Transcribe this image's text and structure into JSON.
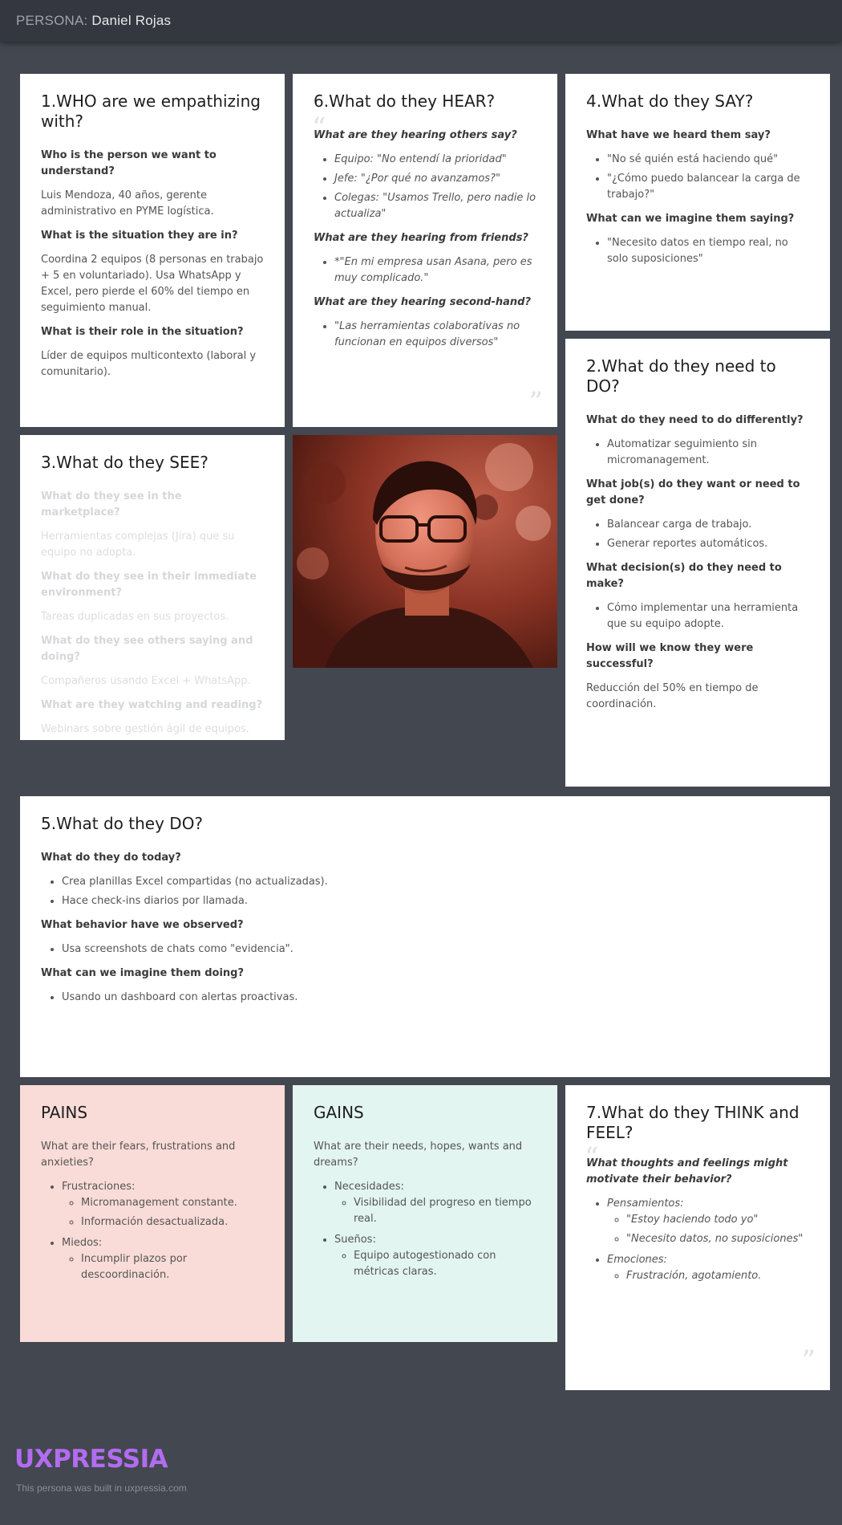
{
  "header": {
    "prefix": "PERSONA:",
    "name": "Daniel Rojas"
  },
  "who": {
    "title": "1.WHO are we empathizing with?",
    "q1": "Who is the person we want to understand?",
    "a1": "Luis Mendoza, 40 años, gerente administrativo en PYME logística.",
    "q2": "What is the situation they are in?",
    "a2": "Coordina 2 equipos (8 personas en trabajo + 5 en voluntariado). Usa WhatsApp y Excel, pero pierde el 60% del tiempo en seguimiento manual.",
    "q3": "What is their role in the situation?",
    "a3": "Líder de equipos multicontexto (laboral y comunitario)."
  },
  "hear": {
    "title": "6.What do they HEAR?",
    "q1": "What are they hearing others say?",
    "items1": [
      "Equipo: \"No entendí la prioridad\"",
      "Jefe: \"¿Por qué no avanzamos?\"",
      "Colegas: \"Usamos Trello, pero nadie lo actualiza\""
    ],
    "q2": "What are they hearing from friends?",
    "items2": [
      "*\"En mi empresa usan Asana, pero es muy complicado.\""
    ],
    "q3": "What are they hearing second-hand?",
    "items3": [
      "\"Las herramientas colaborativas no funcionan en equipos diversos\""
    ]
  },
  "say": {
    "title": "4.What do they SAY?",
    "q1": "What have we heard them say?",
    "items1": [
      "\"No sé quién está haciendo qué\"",
      "\"¿Cómo puedo balancear la carga de trabajo?\""
    ],
    "q2": "What can we imagine them saying?",
    "items2": [
      "\"Necesito datos en tiempo real, no solo suposiciones\""
    ]
  },
  "see": {
    "title": "3.What do they SEE?",
    "q1": "What do they see in the marketplace?",
    "a1": "Herramientas complejas (Jira) que su equipo no adopta.",
    "q2": "What do they see in their immediate environment?",
    "a2": "Tareas duplicadas en sus proyectos.",
    "q3": "What do they see others saying and doing?",
    "a3": "Compañeros usando Excel + WhatsApp.",
    "q4": "What are they watching and reading?",
    "a4": "Webinars sobre gestión ágil de equipos."
  },
  "need": {
    "title": "2.What do they need to DO?",
    "q1": "What do they need to do differently?",
    "items1": [
      "Automatizar seguimiento sin micromanagement."
    ],
    "q2": "What job(s) do they want or need to get done?",
    "items2": [
      "Balancear carga de trabajo.",
      "Generar reportes automáticos."
    ],
    "q3": "What decision(s) do they need to make?",
    "items3": [
      "Cómo implementar una herramienta que su equipo adopte."
    ],
    "q4": "How will we know they were successful?",
    "a4": "Reducción del 50% en tiempo de coordinación."
  },
  "do": {
    "title": "5.What do they DO?",
    "q1": "What do they do today?",
    "items1": [
      "Crea planillas Excel compartidas (no actualizadas).",
      "Hace check-ins diarios por llamada."
    ],
    "q2": "What behavior have we observed?",
    "items2": [
      "Usa screenshots de chats como \"evidencia\"."
    ],
    "q3": "What can we imagine them doing?",
    "items3": [
      "Usando un dashboard con alertas proactivas."
    ]
  },
  "pains": {
    "title": "PAINS",
    "intro": "What are their fears, frustrations and anxieties?",
    "group1": "Frustraciones:",
    "group1_items": [
      "Micromanagement constante.",
      "Información desactualizada."
    ],
    "group2": "Miedos:",
    "group2_items": [
      "Incumplir plazos por descoordinación."
    ]
  },
  "gains": {
    "title": "GAINS",
    "intro": "What are their needs, hopes, wants and dreams?",
    "group1": "Necesidades:",
    "group1_items": [
      "Visibilidad del progreso en tiempo real."
    ],
    "group2": "Sueños:",
    "group2_items": [
      "Equipo autogestionado con métricas claras."
    ]
  },
  "think": {
    "title": "7.What do they THINK and FEEL?",
    "q1": "What thoughts and feelings might motivate their behavior?",
    "group1": "Pensamientos:",
    "group1_items": [
      "\"Estoy haciendo todo yo\"",
      "\"Necesito datos, no suposiciones\""
    ],
    "group2": "Emociones:",
    "group2_items": [
      "Frustración, agotamiento."
    ]
  },
  "footer": {
    "logo": "UXPRESSIA",
    "note": "This persona was built in uxpressia.com"
  },
  "colors": {
    "background": "#434750",
    "topbar": "#34373f",
    "pains": "#f9dcd7",
    "gains": "#e2f5f1",
    "logo": "#b26cf0"
  },
  "icons": {
    "quote_open": "quote-open-icon",
    "quote_close": "quote-close-icon"
  }
}
